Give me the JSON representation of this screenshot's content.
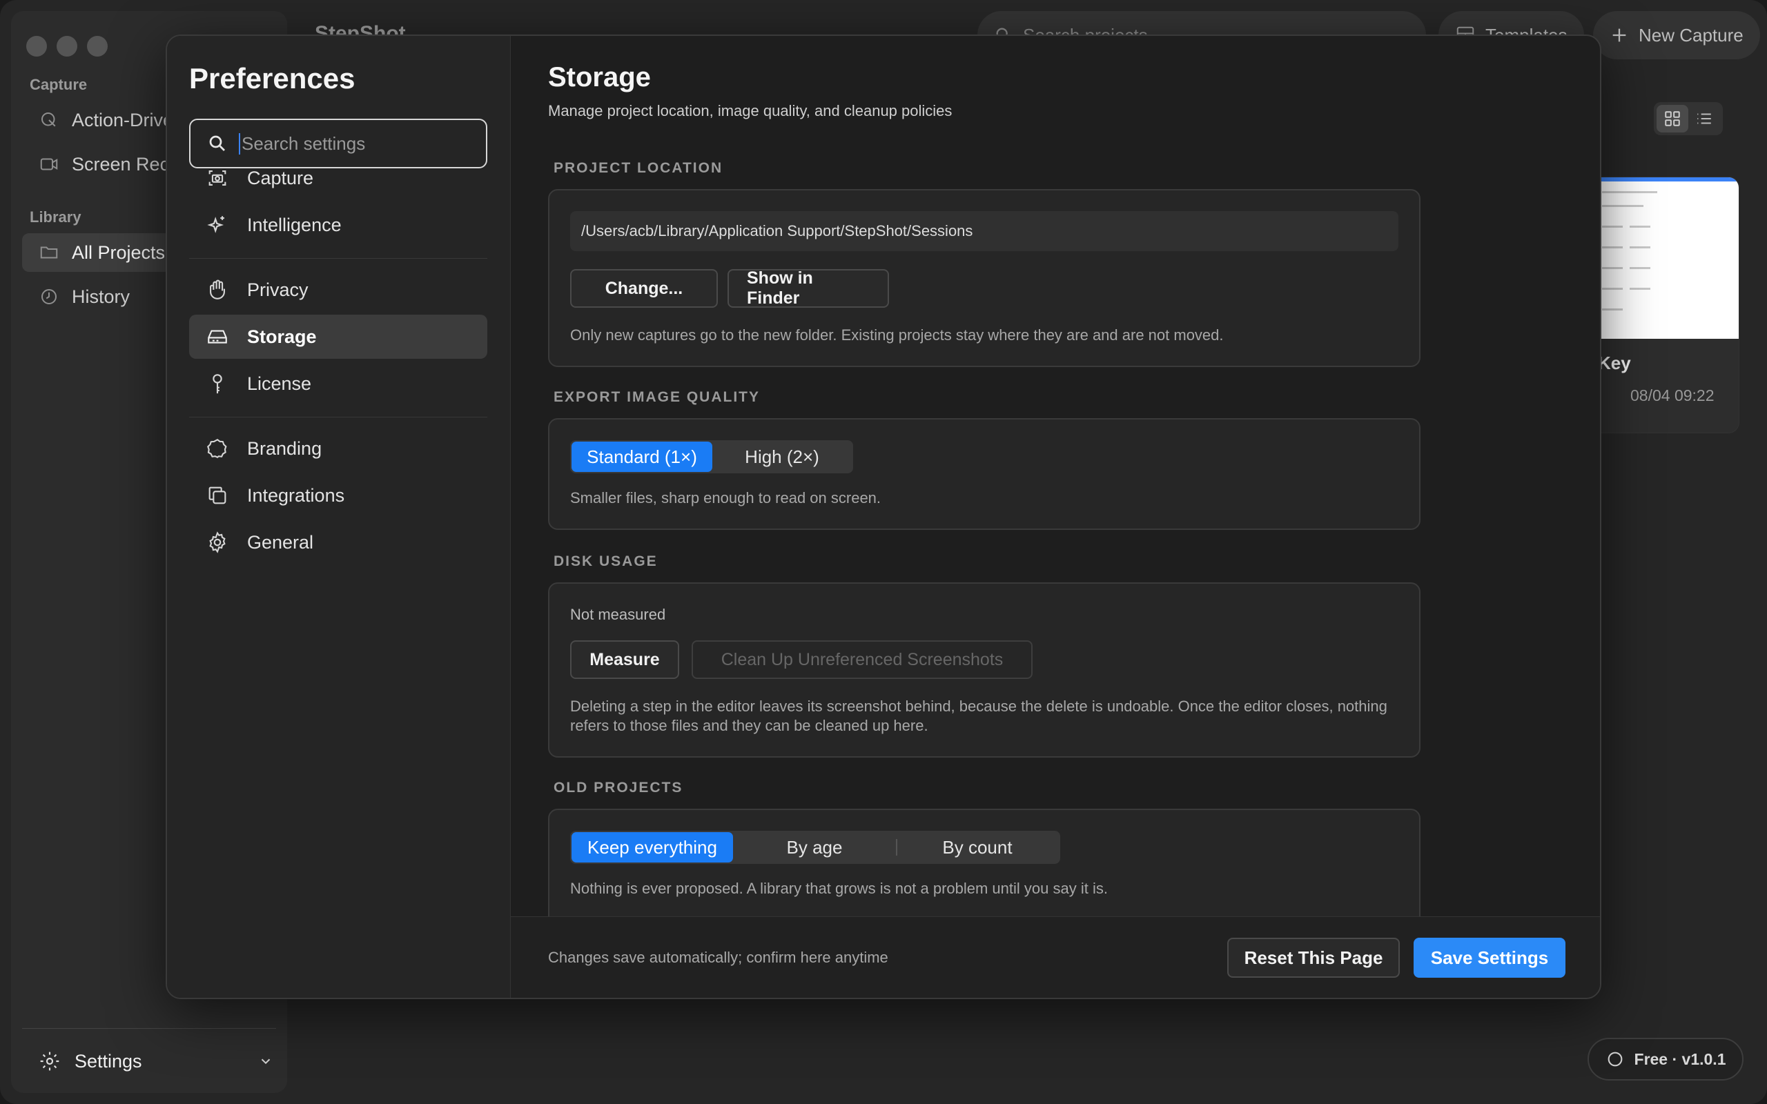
{
  "app": {
    "title": "StepShot",
    "sidebar": {
      "capture_section": "Capture",
      "capture_items": [
        {
          "label": "Action-Driven",
          "icon": "cursor-click-icon"
        },
        {
          "label": "Screen Recording",
          "icon": "video-camera-icon"
        }
      ],
      "library_section": "Library",
      "library_items": [
        {
          "label": "All Projects",
          "icon": "folder-icon",
          "active": true
        },
        {
          "label": "History",
          "icon": "clock-icon"
        }
      ],
      "settings_label": "Settings"
    },
    "search_placeholder": "Search projects",
    "templates_label": "Templates",
    "new_capture_label": "New Capture",
    "card": {
      "title": "Key",
      "date": "08/04 09:22"
    },
    "plan_badge": "Free · v1.0.1"
  },
  "preferences": {
    "title": "Preferences",
    "search_placeholder": "Search settings",
    "nav": [
      {
        "label": "Capture",
        "icon": "camera-icon"
      },
      {
        "label": "Intelligence",
        "icon": "sparkle-icon"
      },
      {
        "label": "Privacy",
        "icon": "hand-icon"
      },
      {
        "label": "Storage",
        "icon": "hard-drive-icon",
        "active": true
      },
      {
        "label": "License",
        "icon": "key-icon"
      },
      {
        "label": "Branding",
        "icon": "badge-icon"
      },
      {
        "label": "Integrations",
        "icon": "copy-icon"
      },
      {
        "label": "General",
        "icon": "gear-icon"
      }
    ]
  },
  "storage": {
    "title": "Storage",
    "subtitle": "Manage project location, image quality, and cleanup policies",
    "project_location": {
      "heading": "PROJECT LOCATION",
      "path": "/Users/acb/Library/Application Support/StepShot/Sessions",
      "change_label": "Change...",
      "show_label": "Show in Finder",
      "note": "Only new captures go to the new folder. Existing projects stay where they are and are not moved."
    },
    "export_quality": {
      "heading": "EXPORT IMAGE QUALITY",
      "options": [
        "Standard (1×)",
        "High (2×)"
      ],
      "selected": "Standard (1×)",
      "note": "Smaller files, sharp enough to read on screen."
    },
    "disk_usage": {
      "heading": "DISK USAGE",
      "status": "Not measured",
      "measure_label": "Measure",
      "cleanup_label": "Clean Up Unreferenced Screenshots",
      "note": "Deleting a step in the editor leaves its screenshot behind, because the delete is undoable. Once the editor closes, nothing refers to those files and they can be cleaned up here."
    },
    "old_projects": {
      "heading": "OLD PROJECTS",
      "options": [
        "Keep everything",
        "By age",
        "By count"
      ],
      "selected": "Keep everything",
      "note": "Nothing is ever proposed. A library that grows is not a problem until you say it is."
    }
  },
  "footer": {
    "note": "Changes save automatically; confirm here anytime",
    "reset_label": "Reset This Page",
    "save_label": "Save Settings"
  },
  "colors": {
    "accent": "#1a7cf5",
    "save_button": "#2b8af7",
    "modal_bg": "#1e1e1e",
    "sidebar_bg": "#252525"
  }
}
